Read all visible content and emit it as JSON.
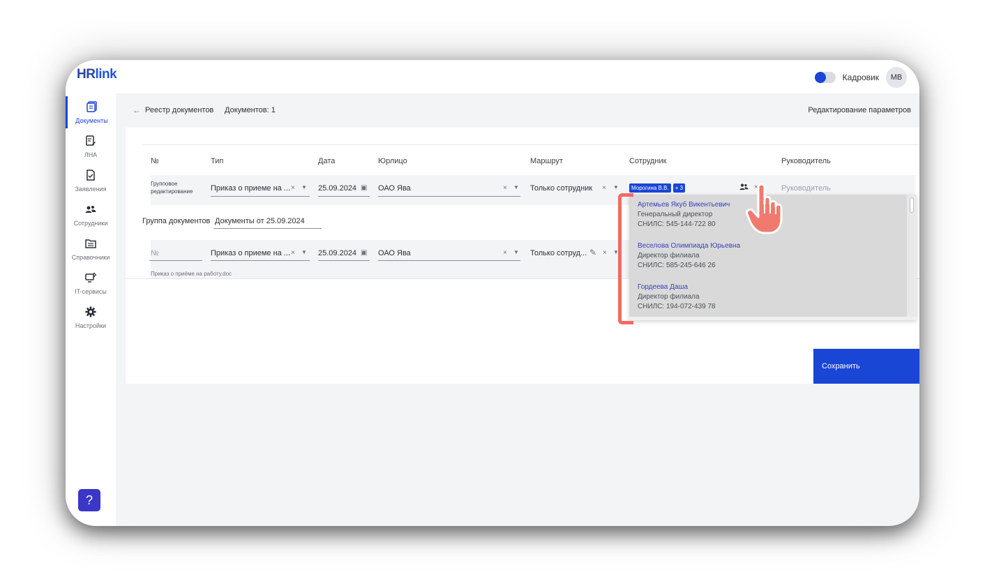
{
  "app": {
    "logo_prefix": "HR",
    "logo_suffix": "link",
    "role": "Кадровик",
    "avatar_initials": "МВ",
    "toggle_on": true
  },
  "sidebar": {
    "items": [
      {
        "label": "Документы",
        "icon": "documents-icon",
        "active": true
      },
      {
        "label": "ЛНА",
        "icon": "lna-doc-icon"
      },
      {
        "label": "Заявления",
        "icon": "application-icon"
      },
      {
        "label": "Сотрудники",
        "icon": "employees-icon"
      },
      {
        "label": "Справочники",
        "icon": "folder-icon"
      },
      {
        "label": "IT-сервисы",
        "icon": "it-services-icon"
      },
      {
        "label": "Настройки",
        "icon": "gear-icon"
      }
    ],
    "help": "?"
  },
  "header": {
    "back_arrow": "←",
    "breadcrumb": "Реестр документов",
    "doc_count": "Документов: 1",
    "edit_params": "Редактирование параметров"
  },
  "table": {
    "columns": [
      "№",
      "Тип",
      "Дата",
      "Юрлицо",
      "Маршрут",
      "Сотрудник",
      "Руководитель"
    ],
    "group_row": {
      "label_line1": "Групповое",
      "label_line2": "редактирование",
      "type": "Приказ о приеме на ...",
      "date": "25.09.2024",
      "entity": "ОАО Ява",
      "route": "Только сотрудник",
      "employee_tag": "Морогина В.В.",
      "employee_more": "+ 3",
      "manager_placeholder": "Руководитель"
    },
    "group_docs": {
      "label": "Группа документов",
      "value": "Документы от 25.09.2024"
    },
    "doc_row": {
      "number_placeholder": "№",
      "type": "Приказ о приеме на ...",
      "date": "25.09.2024",
      "entity": "ОАО Ява",
      "route": "Только сотруд...",
      "file": "Приказ о приёме на работу.doc"
    }
  },
  "dropdown": {
    "items": [
      {
        "name": "Артемьев Якуб Викентьевич",
        "position": "Генеральный директор",
        "snils": "СНИЛС: 545-144-722 80"
      },
      {
        "name": "Веселова Олимпиада Юрьевна",
        "position": "Директор филиала",
        "snils": "СНИЛС: 585-245-646 26"
      },
      {
        "name": "Гордеева Даша",
        "position": "Директор филиала",
        "snils": "СНИЛС: 194-072-439 78"
      }
    ]
  },
  "actions": {
    "save": "Сохранить"
  },
  "colors": {
    "accent": "#1a46d6",
    "annotation": "#f26b62",
    "help_button": "#3a36c6"
  }
}
